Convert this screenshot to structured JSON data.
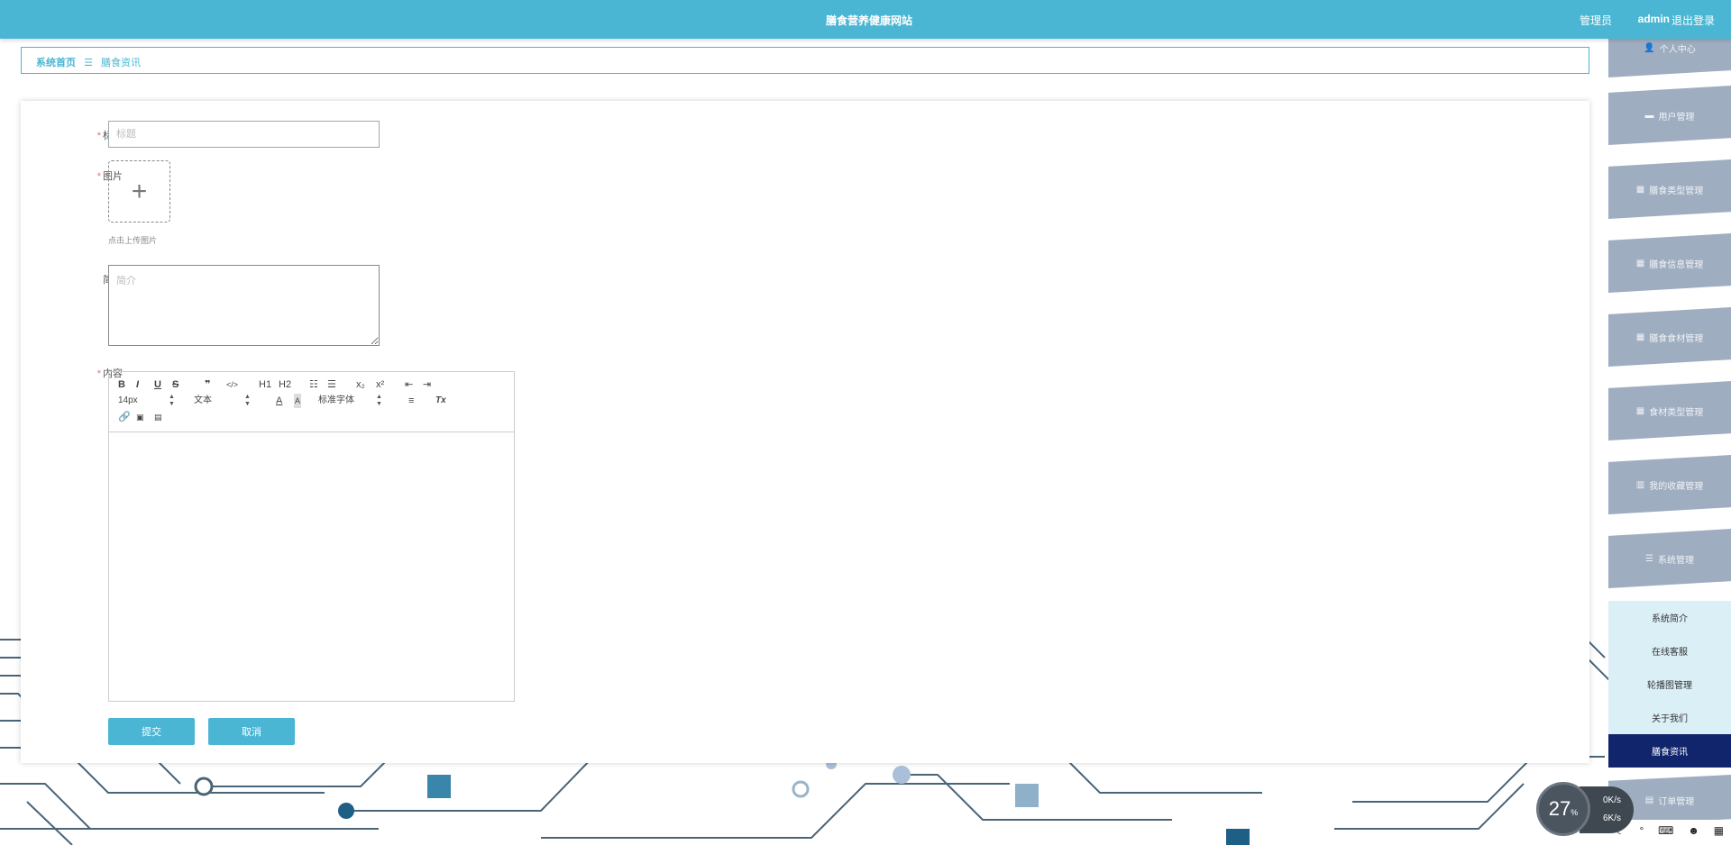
{
  "header": {
    "title": "膳食营养健康网站",
    "role": "管理员",
    "username": "admin",
    "logout": "退出登录"
  },
  "breadcrumb": {
    "home": "系统首页",
    "current": "膳食资讯"
  },
  "form": {
    "title_label": "标题",
    "title_placeholder": "标题",
    "image_label": "图片",
    "upload_hint": "点击上传图片",
    "intro_label": "简介",
    "intro_placeholder": "简介",
    "content_label": "内容",
    "submit": "提交",
    "cancel": "取消"
  },
  "editor": {
    "bold": "B",
    "italic": "I",
    "underline": "U",
    "strike": "S",
    "quote": "❞",
    "code": "</>",
    "h1": "H1",
    "h2": "H2",
    "sub": "x₂",
    "sup": "x²",
    "size": "14px",
    "header": "文本",
    "font": "标准字体",
    "clean": "Tx"
  },
  "sidebar": {
    "items": [
      {
        "label": "个人中心",
        "icon": "user-icon"
      },
      {
        "label": "用户管理",
        "icon": "briefcase-icon"
      },
      {
        "label": "膳食类型管理",
        "icon": "grid-icon"
      },
      {
        "label": "膳食信息管理",
        "icon": "grid-icon"
      },
      {
        "label": "膳食食材管理",
        "icon": "grid-icon"
      },
      {
        "label": "食材类型管理",
        "icon": "grid-icon"
      },
      {
        "label": "我的收藏管理",
        "icon": "trash-icon"
      },
      {
        "label": "系统管理",
        "icon": "list-icon"
      }
    ],
    "sub_items": [
      "系统简介",
      "在线客服",
      "轮播图管理",
      "关于我们",
      "膳食资讯"
    ],
    "bottom": "订单管理"
  },
  "widget": {
    "percent": "27",
    "up": "0K/s",
    "down": "6K/s"
  },
  "colors": {
    "primary": "#4ab6d3",
    "menu": "#9eadc0",
    "active": "#10256b"
  }
}
